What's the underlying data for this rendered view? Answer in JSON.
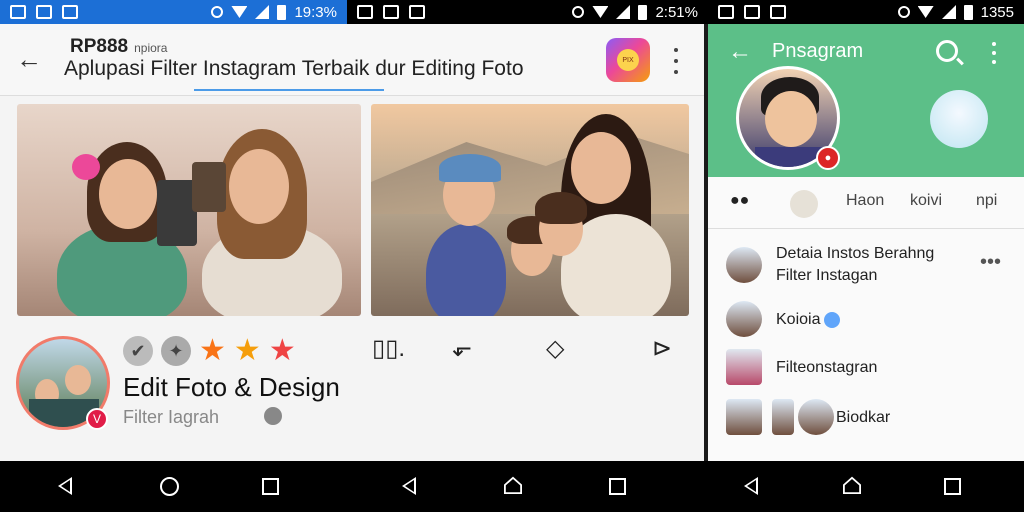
{
  "status": {
    "left_time": "19:3%",
    "mid_time": "2:51%",
    "right_time": "1355"
  },
  "left_app": {
    "title_top": "RP888",
    "title_top_small": "npiora",
    "title_main": "Aplupasi Filter Instagram Terbaik dur Editing Foto",
    "app_icon_text": "PIX",
    "app_name": "Edit Foto & Design",
    "app_sub": "Filter Iagrah",
    "avatar_badge": "V",
    "check_glyph": "✔",
    "stars": [
      "★",
      "★",
      "★"
    ],
    "actions": [
      "▯▯.",
      "⬐",
      "◇",
      "⊳"
    ]
  },
  "right_app": {
    "title": "Pnsagram",
    "tabs": [
      "Haon",
      "koivi",
      "npi"
    ],
    "tab_ico_label": "●●",
    "list": [
      {
        "label": "Detaia Instos Berahng\nFilter Instagan",
        "has_more": true
      },
      {
        "label": "Koioia",
        "has_more": false
      },
      {
        "label": "Filteonstagran",
        "has_more": false
      },
      {
        "label": "Biodkar",
        "has_more": false
      }
    ],
    "more_glyph": "•••"
  },
  "nav": {
    "back": "back",
    "home": "home",
    "recent": "recent"
  }
}
